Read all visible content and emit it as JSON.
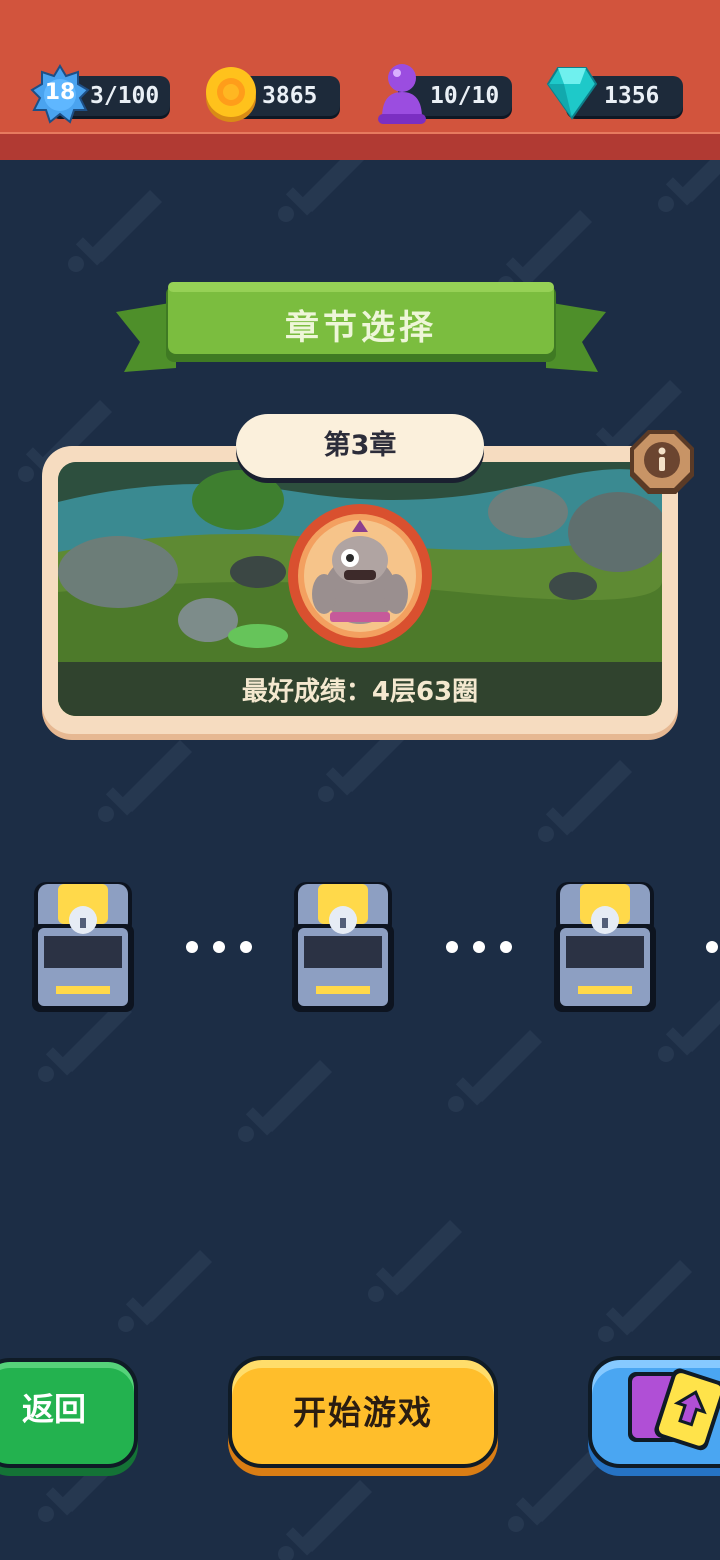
{
  "resources": {
    "level": {
      "badge": "18",
      "value": "3/100"
    },
    "gold": {
      "value": "3865"
    },
    "energy": {
      "value": "10/10"
    },
    "gems": {
      "value": "1356"
    }
  },
  "header": {
    "title": "章节选择"
  },
  "chapter": {
    "name": "第3章",
    "best_score": "最好成绩：4层63圈"
  },
  "buttons": {
    "back": "返回",
    "start": "开始游戏"
  },
  "icons": [
    "level-star-icon",
    "gold-coin-icon",
    "energy-pawn-icon",
    "gem-icon",
    "info-icon",
    "treasure-chest-icon",
    "cards-upgrade-icon"
  ],
  "colors": {
    "topbar": "#d2543d",
    "background": "#1c2d45",
    "ribbon": "#7bbd3f",
    "start_button": "#ffbe2b",
    "back_button": "#23b24f",
    "cards_button": "#4aa6f2"
  }
}
